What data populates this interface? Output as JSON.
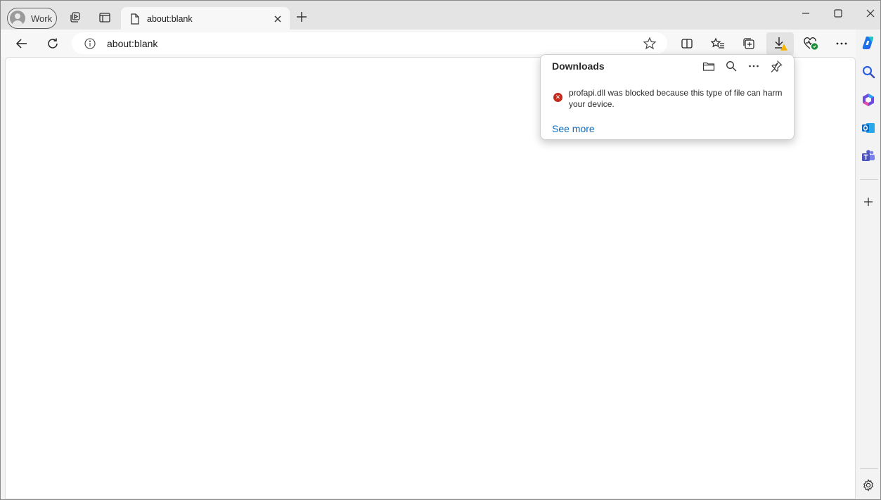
{
  "profile": {
    "label": "Work"
  },
  "tab": {
    "title": "about:blank"
  },
  "address_bar": {
    "url": "about:blank"
  },
  "downloads": {
    "title": "Downloads",
    "items": [
      {
        "message": "profapi.dll was blocked because this type of file can harm your device.",
        "status": "blocked"
      }
    ],
    "see_more": "See more"
  },
  "colors": {
    "error": "#c42b1c",
    "link": "#0f6cbd",
    "warning": "#f4b400"
  }
}
